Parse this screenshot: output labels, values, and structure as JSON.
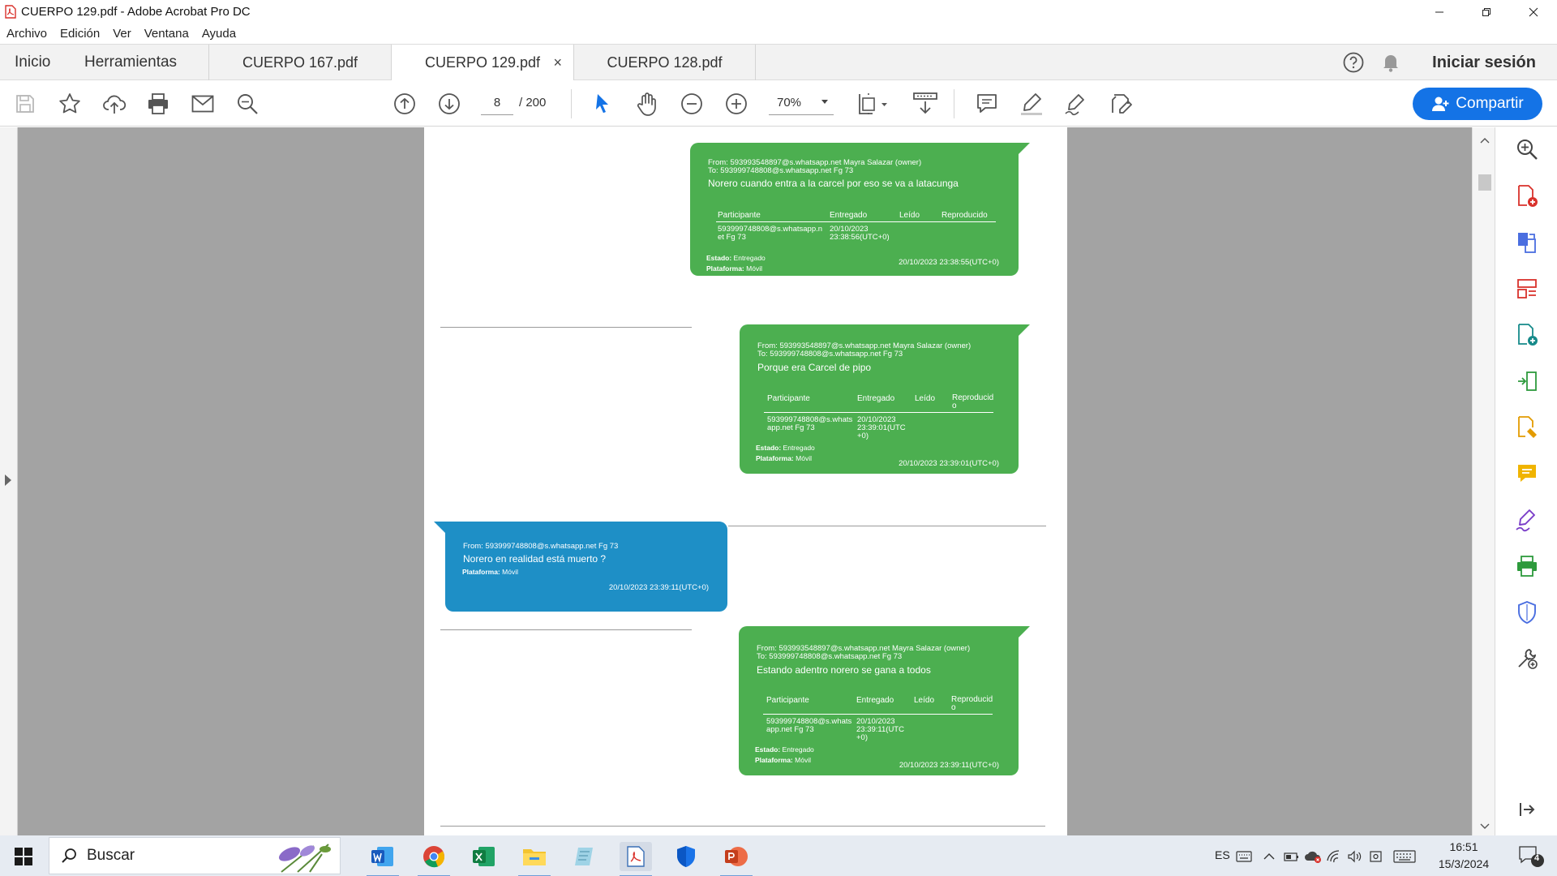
{
  "window": {
    "title": "CUERPO 129.pdf - Adobe Acrobat Pro DC"
  },
  "menu": [
    "Archivo",
    "Edición",
    "Ver",
    "Ventana",
    "Ayuda"
  ],
  "tabs": {
    "home": "Inicio",
    "tools": "Herramientas",
    "documents": [
      {
        "label": "CUERPO 167.pdf",
        "active": false
      },
      {
        "label": "CUERPO 129.pdf",
        "active": true
      },
      {
        "label": "CUERPO 128.pdf",
        "active": false
      }
    ],
    "close_symbol": "×",
    "sign_in": "Iniciar sesión"
  },
  "toolbar": {
    "current_page": "8",
    "total_pages": "/ 200",
    "zoom": "70%",
    "share_label": "Compartir",
    "share_color": "#1473e6"
  },
  "messages": [
    {
      "side": "right",
      "color": "#4caf50",
      "from": "From: 593993548897@s.whatsapp.net Mayra Salazar (owner)",
      "to": "To: 593999748808@s.whatsapp.net Fg 73",
      "text": "Norero cuando entra a la carcel por eso se va a latacunga",
      "table_headers": [
        "Participante",
        "Entregado",
        "Leído",
        "Reproducido"
      ],
      "participant": [
        "593999748808@s.whatsapp.n",
        "et Fg 73"
      ],
      "delivered": [
        "20/10/2023",
        "23:38:56(UTC+0)"
      ],
      "estado_label": "Estado:",
      "estado": "Entregado",
      "plataforma_label": "Plataforma:",
      "plataforma": "Móvil",
      "timestamp": "20/10/2023 23:38:55(UTC+0)"
    },
    {
      "side": "right",
      "color": "#4caf50",
      "from": "From: 593993548897@s.whatsapp.net Mayra Salazar (owner)",
      "to": "To: 593999748808@s.whatsapp.net Fg 73",
      "text": "Porque era Carcel de pipo",
      "table_headers": [
        "Participante",
        "Entregado",
        "Leído",
        "Reproducid",
        "o"
      ],
      "participant": [
        "593999748808@s.whats",
        "app.net Fg 73"
      ],
      "delivered": [
        "20/10/2023",
        "23:39:01(UTC",
        "+0)"
      ],
      "estado_label": "Estado:",
      "estado": "Entregado",
      "plataforma_label": "Plataforma:",
      "plataforma": "Móvil",
      "timestamp": "20/10/2023 23:39:01(UTC+0)"
    },
    {
      "side": "left",
      "color": "#1e8fc6",
      "from": "From: 593999748808@s.whatsapp.net Fg 73",
      "text": "Norero en realidad está muerto ?",
      "plataforma_label": "Plataforma:",
      "plataforma": "Móvil",
      "timestamp": "20/10/2023 23:39:11(UTC+0)"
    },
    {
      "side": "right",
      "color": "#4caf50",
      "from": "From: 593993548897@s.whatsapp.net Mayra Salazar (owner)",
      "to": "To: 593999748808@s.whatsapp.net Fg 73",
      "text": "Estando adentro norero se gana a todos",
      "table_headers": [
        "Participante",
        "Entregado",
        "Leído",
        "Reproducid",
        "o"
      ],
      "participant": [
        "593999748808@s.whats",
        "app.net Fg 73"
      ],
      "delivered": [
        "20/10/2023",
        "23:39:11(UTC",
        "+0)"
      ],
      "estado_label": "Estado:",
      "estado": "Entregado",
      "plataforma_label": "Plataforma:",
      "plataforma": "Móvil",
      "timestamp": "20/10/2023 23:39:11(UTC+0)"
    }
  ],
  "taskbar": {
    "search_label": "Buscar",
    "language": "ES",
    "time": "16:51",
    "date": "15/3/2024",
    "notification_count": "4",
    "apps": [
      "word-icon",
      "chrome-icon",
      "excel-icon",
      "file-explorer-icon",
      "notes-icon",
      "acrobat-icon",
      "defender-icon",
      "powerpoint-icon"
    ]
  }
}
